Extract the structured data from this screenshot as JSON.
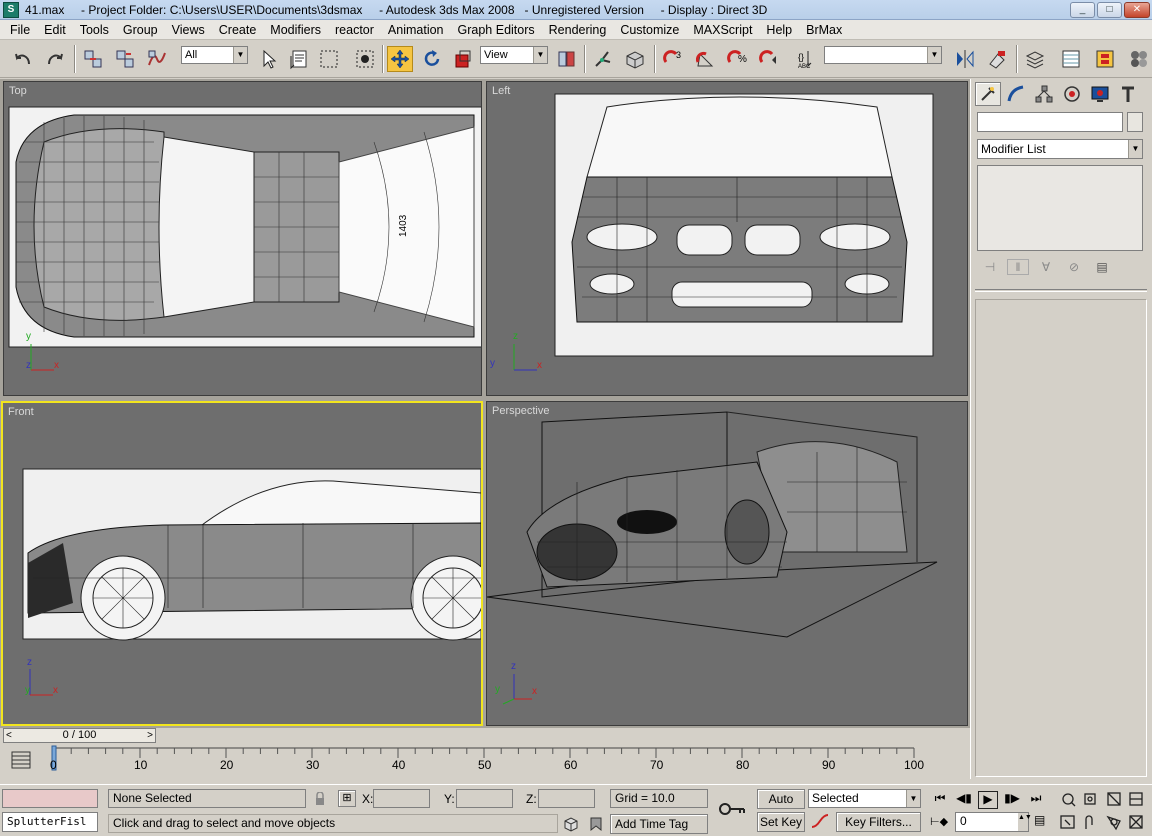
{
  "window": {
    "title": "41.max     - Project Folder: C:\\Users\\USER\\Documents\\3dsmax     - Autodesk 3ds Max 2008   - Unregistered Version     - Display : Direct 3D",
    "minimize": "_",
    "maximize": "□",
    "close": "✕"
  },
  "menu": [
    "File",
    "Edit",
    "Tools",
    "Group",
    "Views",
    "Create",
    "Modifiers",
    "reactor",
    "Animation",
    "Graph Editors",
    "Rendering",
    "Customize",
    "MAXScript",
    "Help",
    "BrMax"
  ],
  "toolbar": {
    "selection_filter": "All",
    "ref_coord": "View",
    "named_selection": "",
    "icons": [
      "undo-icon",
      "redo-icon",
      "select-link-icon",
      "unlink-icon",
      "bind-space-warp-icon",
      "select-object-icon",
      "select-by-name-icon",
      "rect-region-icon",
      "window-crossing-icon",
      "select-move-icon",
      "select-rotate-icon",
      "select-scale-icon",
      "mirror-icon",
      "align-icon"
    ]
  },
  "viewports": {
    "top": {
      "label": "Top",
      "axis_h": "x",
      "axis_v": "y",
      "axis_o": "z",
      "dim": "1403"
    },
    "left": {
      "label": "Left",
      "axis_h": "y",
      "axis_v": "z",
      "axis_o": "x"
    },
    "front": {
      "label": "Front",
      "axis_h": "x",
      "axis_v": "z",
      "axis_o": "y"
    },
    "perspective": {
      "label": "Perspective",
      "axis_h": "x",
      "axis_v": "z",
      "axis_o": "y"
    }
  },
  "command_panel": {
    "name_field": "",
    "modifier_list": "Modifier List"
  },
  "timeline": {
    "slider": "0 / 100",
    "prev": "<",
    "next": ">",
    "ticks": [
      "0",
      "10",
      "20",
      "30",
      "40",
      "50",
      "60",
      "70",
      "80",
      "90",
      "100"
    ]
  },
  "status": {
    "script_listener": "SplutterFisl",
    "selection": "None Selected",
    "prompt": "Click and drag to select and move objects",
    "x_label": "X:",
    "y_label": "Y:",
    "z_label": "Z:",
    "x_value": "",
    "y_value": "",
    "z_value": "",
    "grid": "Grid = 10.0",
    "add_time_tag": "Add Time Tag",
    "auto_key": "Auto Key",
    "set_key": "Set Key",
    "selected": "Selected",
    "key_filters": "Key Filters...",
    "frame": "0"
  },
  "colors": {
    "active_viewport": "#f2e51e",
    "active_tool": "#f5c542",
    "viewport_bg": "#6e6e6e"
  }
}
